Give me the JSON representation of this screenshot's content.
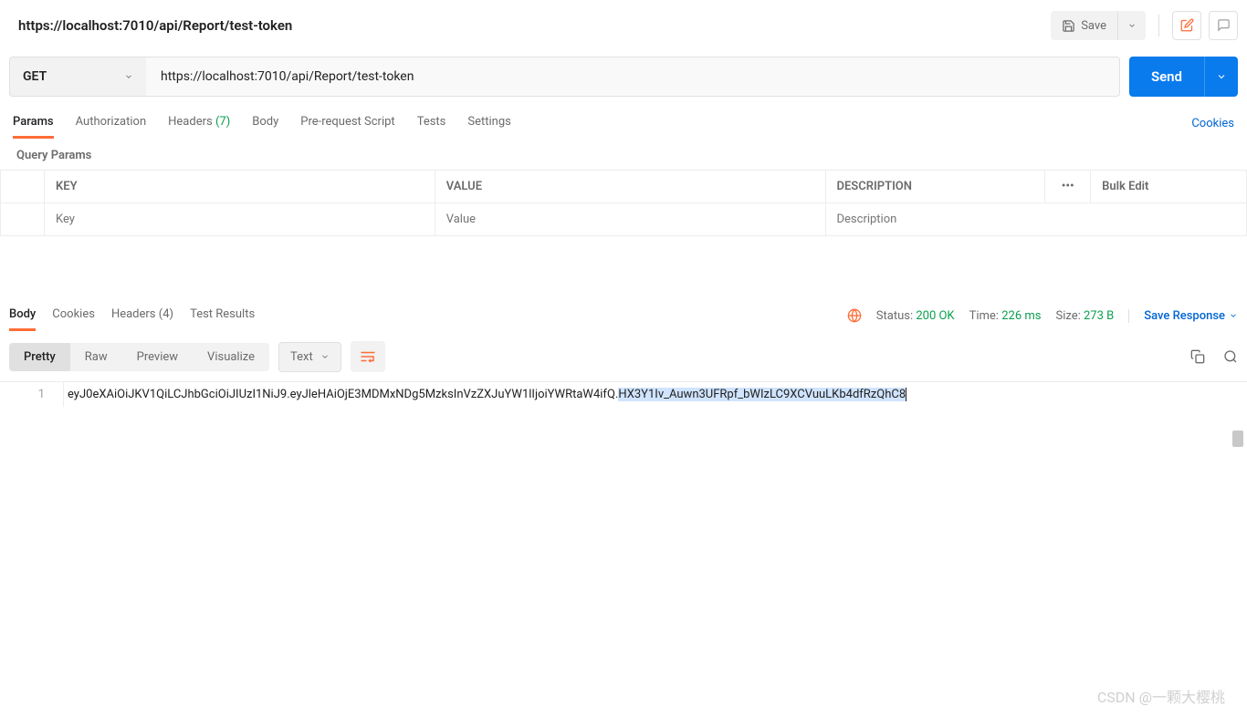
{
  "header": {
    "title": "https://localhost:7010/api/Report/test-token",
    "save_label": "Save"
  },
  "request": {
    "method": "GET",
    "url": "https://localhost:7010/api/Report/test-token",
    "send_label": "Send"
  },
  "tabs": {
    "params": "Params",
    "authorization": "Authorization",
    "headers_label": "Headers",
    "headers_count": "(7)",
    "body": "Body",
    "prerequest": "Pre-request Script",
    "tests": "Tests",
    "settings": "Settings",
    "cookies": "Cookies"
  },
  "query_params": {
    "section_label": "Query Params",
    "col_key": "KEY",
    "col_value": "VALUE",
    "col_desc": "DESCRIPTION",
    "bulk_edit": "Bulk Edit",
    "placeholder_key": "Key",
    "placeholder_value": "Value",
    "placeholder_desc": "Description"
  },
  "response": {
    "tabs": {
      "body": "Body",
      "cookies": "Cookies",
      "headers_label": "Headers",
      "headers_count": "(4)",
      "test_results": "Test Results"
    },
    "status_label": "Status:",
    "status_value": "200 OK",
    "time_label": "Time:",
    "time_value": "226 ms",
    "size_label": "Size:",
    "size_value": "273 B",
    "save_response": "Save Response",
    "views": {
      "pretty": "Pretty",
      "raw": "Raw",
      "preview": "Preview",
      "visualize": "Visualize"
    },
    "format": "Text",
    "line_number": "1",
    "body_plain": "eyJ0eXAiOiJKV1QiLCJhbGciOiJIUzI1NiJ9.eyJleHAiOjE3MDMxNDg5MzksInVzZXJuYW1lIjoiYWRtaW4ifQ.",
    "body_highlighted": "HX3Y1Iv_Auwn3UFRpf_bWIzLC9XCVuuLKb4dfRzQhC8"
  },
  "watermark": "CSDN @一颗大樱桃"
}
